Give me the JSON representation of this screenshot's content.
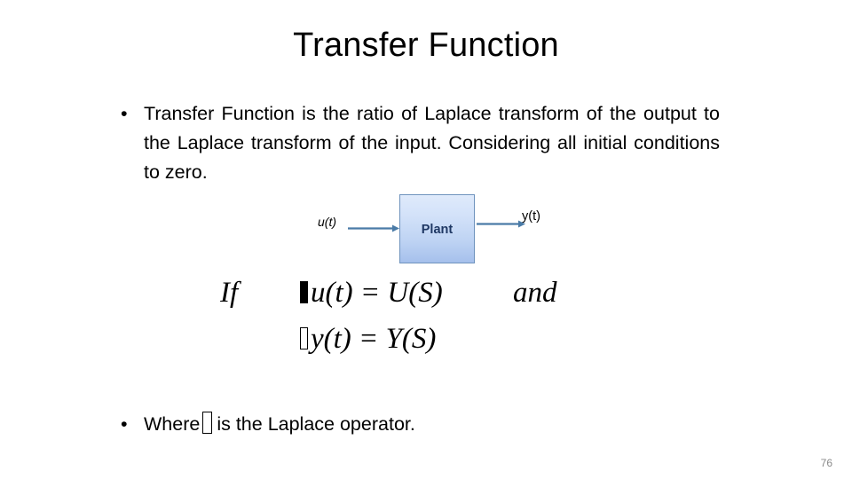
{
  "slide": {
    "title": "Transfer Function",
    "page_number": "76",
    "background_color": "#ffffff"
  },
  "bullets": [
    {
      "marker": "•",
      "text": "Transfer Function is the ratio of Laplace transform of the output to the Laplace transform of the input. Considering all initial conditions to zero."
    }
  ],
  "diagram": {
    "input_label": "u(t)",
    "block_label": "Plant",
    "output_label": "y(t)",
    "arrow_color": "#4a7ba7",
    "block_border_color": "#6f93bd",
    "block_fill_top": "#dfeafb",
    "block_fill_bottom": "#a6c0ec",
    "block_text_color": "#1f3864"
  },
  "equations": {
    "line1": {
      "prefix": "If",
      "missing_glyph": "▯",
      "body": "u(t) = U(S)",
      "suffix": "and"
    },
    "line2": {
      "missing_glyph": "▯",
      "body": "y(t) = Y(S)"
    }
  },
  "footer_bullet": {
    "marker": "•",
    "text_before": "Where",
    "missing_glyph": "▯",
    "text_after": "is the Laplace operator."
  }
}
